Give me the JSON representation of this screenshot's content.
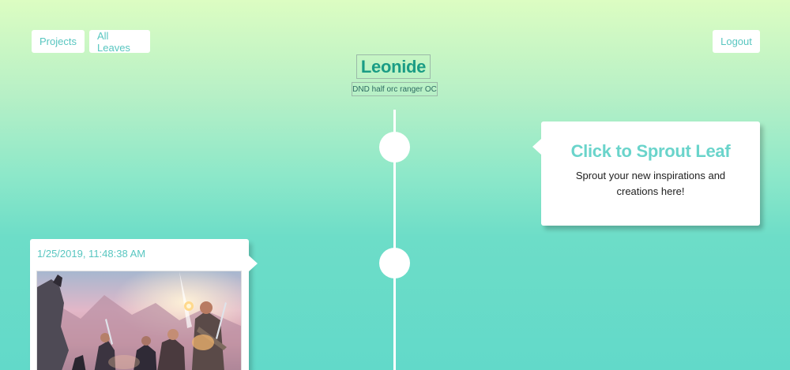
{
  "nav": {
    "projects_label": "Projects",
    "all_leaves_label": "All Leaves",
    "logout_label": "Logout"
  },
  "project": {
    "title": "Leonide",
    "description": "DND half orc ranger OC"
  },
  "sprout_card": {
    "title": "Click to Sprout Leaf",
    "description": "Sprout your new inspirations and creations here!"
  },
  "leaves": [
    {
      "date": "1/25/2019, 11:48:38 AM",
      "image_alt": "fantasy adventurers artwork"
    }
  ],
  "colors": {
    "accent": "#58c6c0",
    "title": "#1a9c85",
    "background_top": "#dcfdc2",
    "background_bottom": "#62d9c9"
  }
}
